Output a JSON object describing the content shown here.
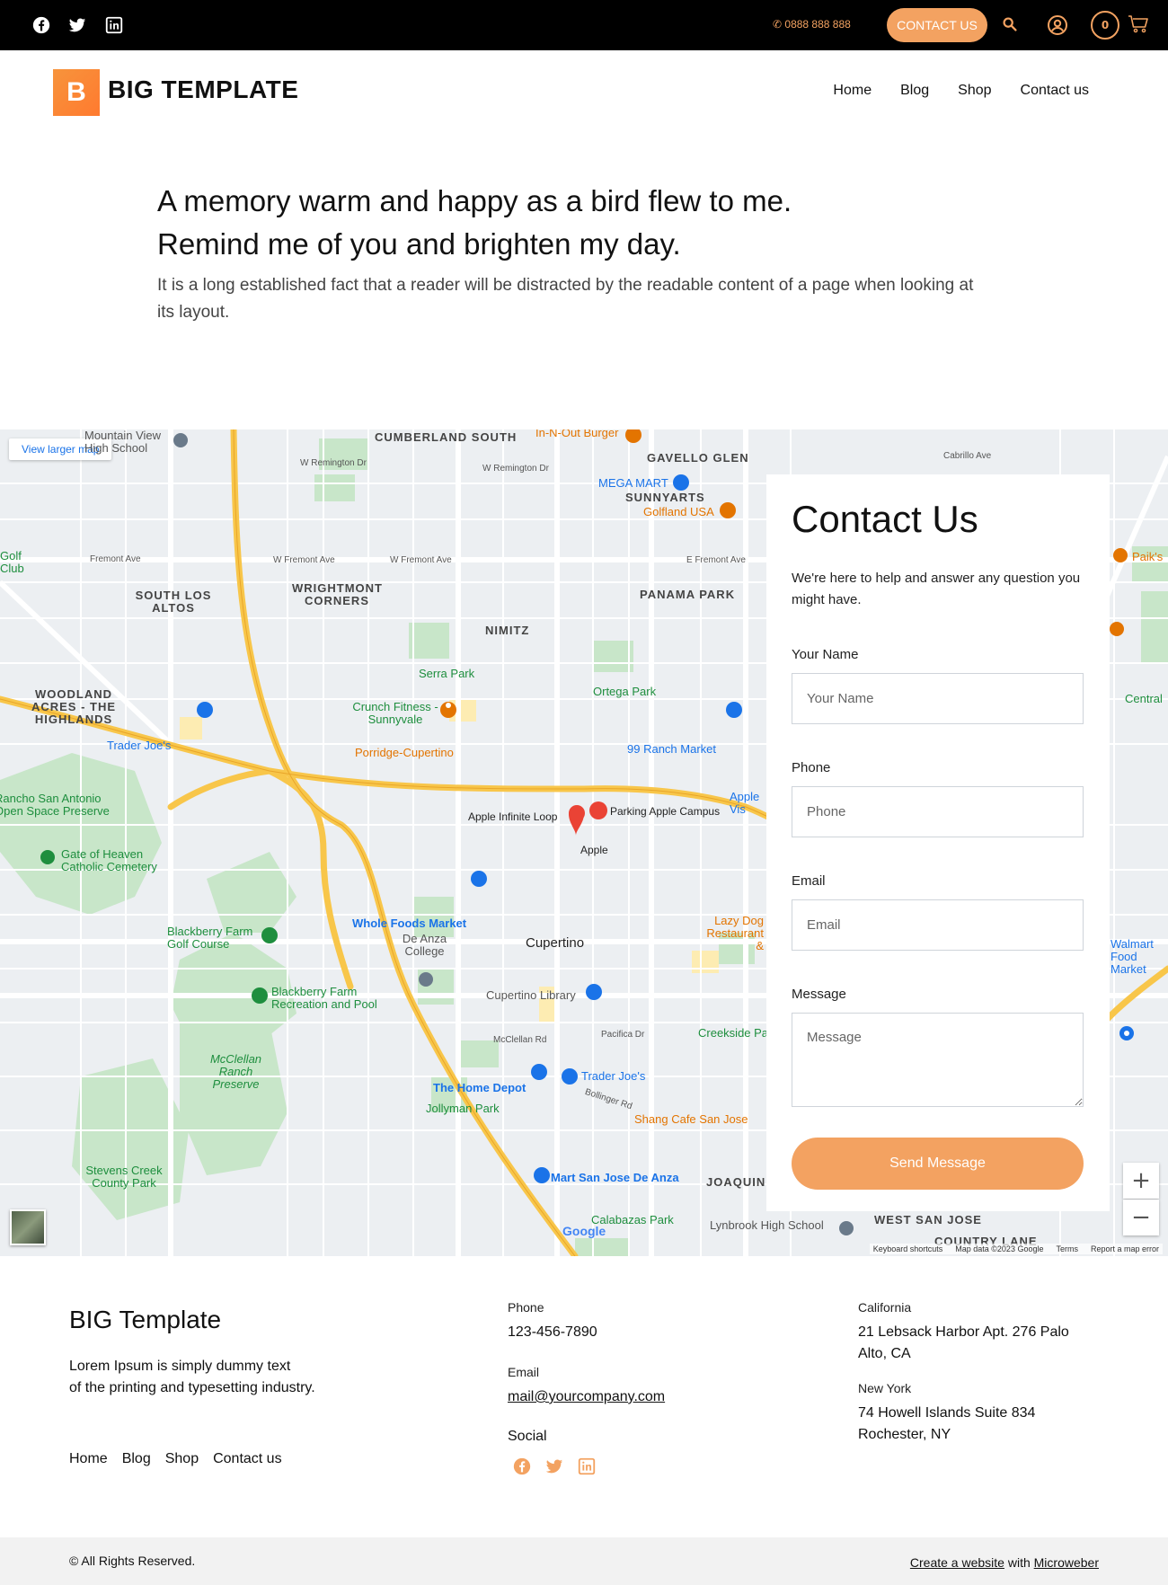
{
  "topbar": {
    "phone": "0888 888 888",
    "cta": "CONTACT US",
    "cart_count": "0",
    "accent": "#f3a261"
  },
  "header": {
    "logo_letter": "B",
    "brand": "BIG TEMPLATE",
    "nav": [
      "Home",
      "Blog",
      "Shop",
      "Contact us"
    ]
  },
  "hero": {
    "title_line1": "A memory warm and happy as a bird flew to me.",
    "title_line2": "Remind me of you and brighten my day.",
    "text": "It is a long established fact that a reader will be distracted by the readable content of a page when looking at its layout."
  },
  "map": {
    "view_larger": "View larger map",
    "labels": {
      "cumberland": "CUMBERLAND SOUTH",
      "gavello": "GAVELLO GLEN",
      "sunnyarts": "SUNNYARTS",
      "south_los_altos": "SOUTH LOS ALTOS",
      "wrightmont": "WRIGHTMONT CORNERS",
      "nimitz": "NIMITZ",
      "panama": "PANAMA PARK",
      "woodland": "WOODLAND ACRES - THE HIGHLANDS",
      "joaquin": "JOAQUIN",
      "west_san_jose": "WEST SAN JOSE",
      "country_lane": "COUNTRY LANE",
      "mountain_view": "Mountain View High School",
      "in_n_out": "In-N-Out Burger",
      "mega_mart": "MEGA MART",
      "golfland": "Golfland USA",
      "serra": "Serra Park",
      "ortega": "Ortega Park",
      "crunch": "Crunch Fitness - Sunnyvale",
      "porridge": "Porridge-Cupertino",
      "ranch99": "99 Ranch Market",
      "trader1": "Trader Joe's",
      "rancho": "Rancho San Antonio Open Space Preserve",
      "apple_loop": "Apple Infinite Loop",
      "parking": "Parking Apple Campus",
      "apple": "Apple",
      "gate": "Gate of Heaven Catholic Cemetery",
      "blackberry_golf": "Blackberry Farm Golf Course",
      "whole": "Whole Foods Market",
      "de_anza": "De Anza College",
      "cupertino": "Cupertino",
      "lazy": "Lazy Dog Restaurant &",
      "blackberry_rec": "Blackberry Farm Recreation and Pool",
      "library": "Cupertino Library",
      "creekside": "Creekside Park",
      "mcclellan": "McClellan Ranch Preserve",
      "home_depot": "The Home Depot",
      "trader2": "Trader Joe's",
      "jollyman": "Jollyman Park",
      "shang": "Shang Cafe San Jose",
      "stevens": "Stevens Creek County Park",
      "hmart": "H Mart San Jose De Anza",
      "calabazas": "Calabazas Park",
      "lynbrook": "Lynbrook High School",
      "golf_club": "Golf Club",
      "central": "Central",
      "walmart": "Walmart Food Market",
      "apple_vis": "Apple Vis",
      "paiks": "Paik's"
    },
    "streets": {
      "remington": "W Remington Dr",
      "remington2": "W Remington Dr",
      "fremont1": "Fremont Ave",
      "fremont2": "W Fremont Ave",
      "fremont3": "W Fremont Ave",
      "fremont4": "E Fremont Ave",
      "mcclellan": "McClellan Rd",
      "pacifica": "Pacifica Dr",
      "bollinger": "Bollinger Rd",
      "cabrillo": "Cabrillo Ave"
    },
    "attribution": [
      "Keyboard shortcuts",
      "Map data ©2023 Google",
      "Terms",
      "Report a map error"
    ],
    "google": "Google",
    "zoom_in": "+",
    "zoom_out": "−"
  },
  "contact": {
    "title": "Contact Us",
    "intro": "We're here to help and answer any question you might have.",
    "name_label": "Your Name",
    "name_placeholder": "Your Name",
    "phone_label": "Phone",
    "phone_placeholder": "Phone",
    "email_label": "Email",
    "email_placeholder": "Email",
    "message_label": "Message",
    "message_placeholder": "Message",
    "send": "Send Message"
  },
  "footer": {
    "title": "BIG Template",
    "desc_line1": "Lorem Ipsum is simply dummy text",
    "desc_line2": "of the printing and typesetting industry.",
    "nav": [
      "Home",
      "Blog",
      "Shop",
      "Contact us"
    ],
    "phone_label": "Phone",
    "phone": "123-456-7890",
    "email_label": "Email",
    "email": "mail@yourcompany.com",
    "social_label": "Social",
    "ca_label": "California",
    "ca_address": "21 Lebsack Harbor Apt. 276 Palo Alto, CA",
    "ny_label": "New York",
    "ny_address": "74 Howell Islands Suite 834 Rochester, NY"
  },
  "bottom": {
    "copyright": "© All Rights Reserved.",
    "create": "Create a website",
    "with": "with",
    "microweber": "Microweber"
  }
}
